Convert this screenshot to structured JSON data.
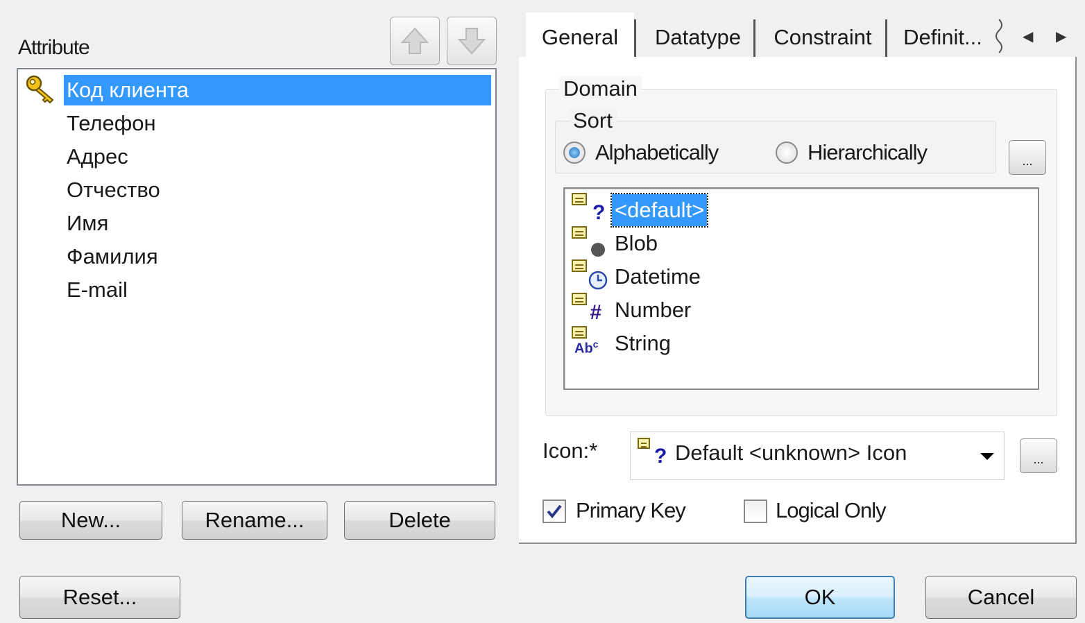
{
  "attributes": {
    "label": "Attribute",
    "items": [
      "Код клиента",
      "Телефон",
      "Адрес",
      "Отчество",
      "Имя",
      "Фамилия",
      "E-mail"
    ],
    "selected_index": 0,
    "buttons": {
      "new": "New...",
      "rename": "Rename...",
      "delete": "Delete"
    }
  },
  "move_buttons": {
    "up_icon": "arrow-up-icon",
    "down_icon": "arrow-down-icon"
  },
  "tabs": [
    "General",
    "Datatype",
    "Constraint",
    "Definit..."
  ],
  "active_tab": "General",
  "domain": {
    "legend": "Domain",
    "sort": {
      "legend": "Sort",
      "options": [
        "Alphabetically",
        "Hierarchically"
      ],
      "selected": "Alphabetically"
    },
    "browse_label": "...",
    "items": [
      "<default>",
      "Blob",
      "Datetime",
      "Number",
      "String"
    ],
    "selected_index": 0
  },
  "icon_field": {
    "label": "Icon:*",
    "value": "Default <unknown> Icon",
    "browse_label": "..."
  },
  "checkboxes": {
    "primary_key": {
      "label": "Primary Key",
      "checked": true
    },
    "logical_only": {
      "label": "Logical Only",
      "checked": false
    }
  },
  "footer": {
    "reset": "Reset...",
    "ok": "OK",
    "cancel": "Cancel"
  },
  "colors": {
    "selection": "#3399ff",
    "accent_border": "#3c7fb1"
  }
}
